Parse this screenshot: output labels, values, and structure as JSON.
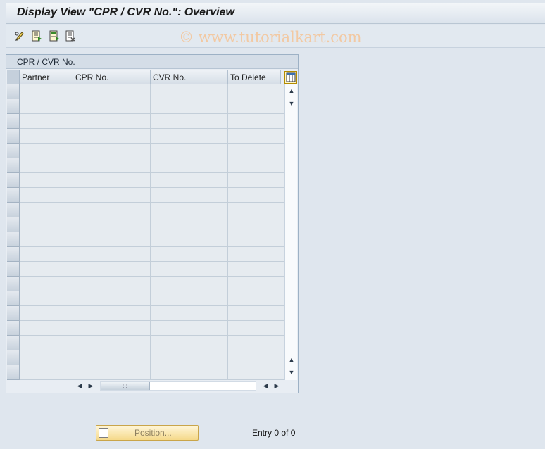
{
  "title": "Display View \"CPR / CVR No.\": Overview",
  "toolbar": {
    "icons": [
      "pencil-glasses-icon",
      "new-entries-icon",
      "copy-as-icon",
      "delete-icon"
    ],
    "watermark": "© www.tutorialkart.com"
  },
  "table": {
    "caption": "CPR / CVR No.",
    "columns": [
      "Partner",
      "CPR No.",
      "CVR No.",
      "To Delete"
    ],
    "rows": []
  },
  "scroll": {
    "up": "▲",
    "down": "▼",
    "left": "◀",
    "right": "▶",
    "thumb": ":::"
  },
  "footer": {
    "position_button": "Position...",
    "entry_info": "Entry 0 of 0"
  },
  "colors": {
    "background": "#dfe6ee",
    "header": "#d4dde7",
    "button": "#f5d98a",
    "watermark": "#f2c9a3"
  }
}
